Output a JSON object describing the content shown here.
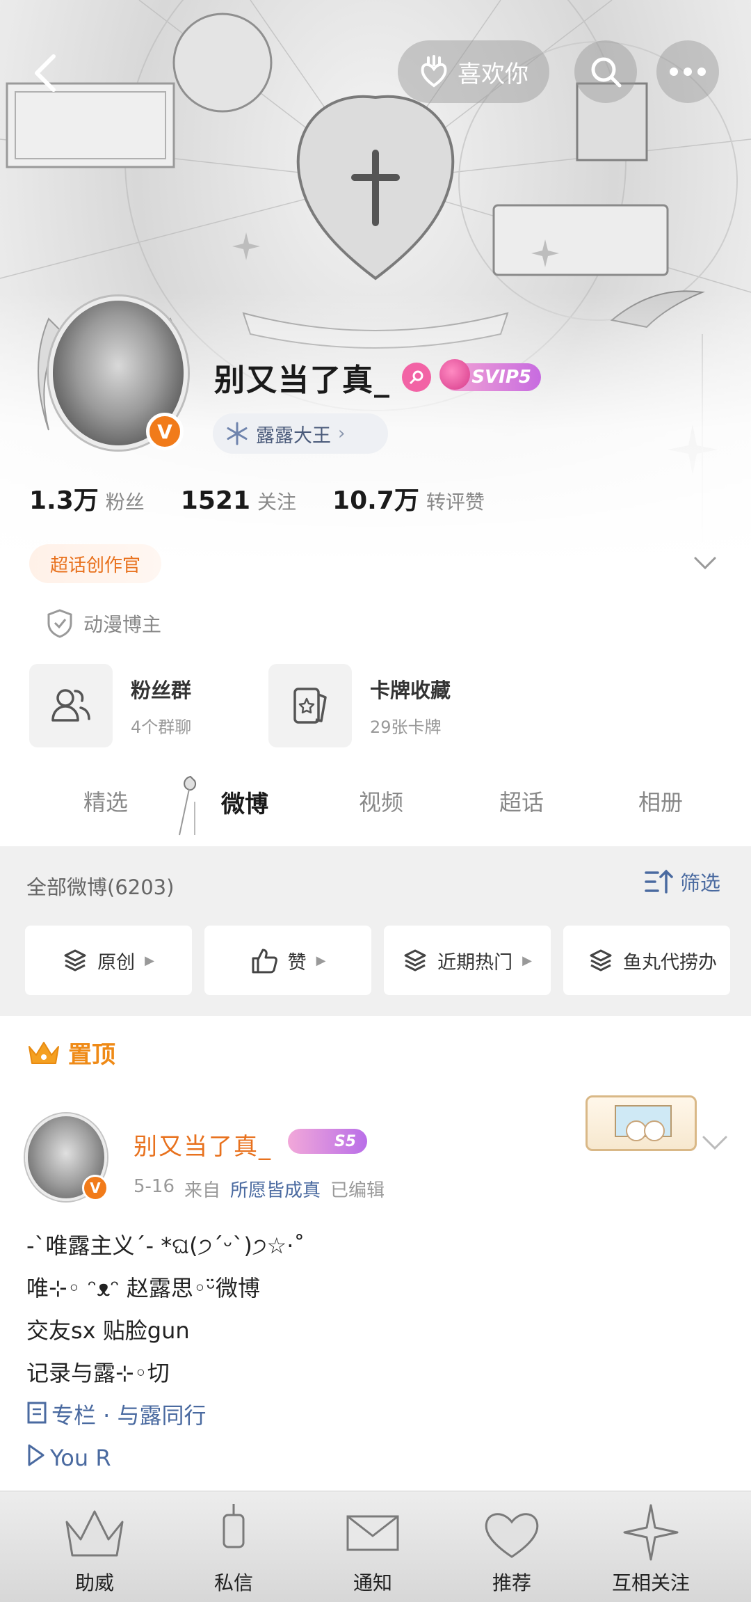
{
  "header": {
    "like_label": "喜欢你",
    "back_icon": "back-arrow-icon",
    "search_icon": "search-icon",
    "more_icon": "more-dots-icon"
  },
  "profile": {
    "nickname": "别又当了真_",
    "svip_label": "SVIP5",
    "group_tag": "露露大王",
    "stats": [
      {
        "value": "1.3万",
        "label": "粉丝"
      },
      {
        "value": "1521",
        "label": "关注"
      },
      {
        "value": "10.7万",
        "label": "转评赞"
      }
    ],
    "creator_tag": "超话创作官",
    "verify_label": "动漫博主",
    "cards": [
      {
        "title": "粉丝群",
        "sub": "4个群聊",
        "icon": "fans-group-icon"
      },
      {
        "title": "卡牌收藏",
        "sub": "29张卡牌",
        "icon": "card-collection-icon"
      }
    ]
  },
  "tabs": [
    {
      "label": "精选",
      "active": false
    },
    {
      "label": "微博",
      "active": true
    },
    {
      "label": "视频",
      "active": false
    },
    {
      "label": "超话",
      "active": false
    },
    {
      "label": "相册",
      "active": false
    }
  ],
  "filter": {
    "all_posts": "全部微博(6203)",
    "filter_label": "筛选",
    "chips": [
      {
        "label": "原创"
      },
      {
        "label": "赞"
      },
      {
        "label": "近期热门"
      },
      {
        "label": "鱼丸代捞办"
      }
    ]
  },
  "post": {
    "pinned_label": "置顶",
    "author": "别又当了真_",
    "level_badge": "S5",
    "date": "5-16",
    "from_label": "来自",
    "source": "所愿皆成真",
    "edited": "已编辑",
    "lines": [
      "-`唯露主义´- *ଘ(੭ˊᵕˋ)੭☆·˚",
      "唯⊹◦ ᵔᴥᵔ 赵露思◦ᵕ̈微博",
      "交友sx 贴脸gun",
      "记录与露⊹◦切",
      "专栏 · 与露同行",
      "You R"
    ]
  },
  "bottom_nav": [
    {
      "label": "助威"
    },
    {
      "label": "私信"
    },
    {
      "label": "通知"
    },
    {
      "label": "推荐"
    },
    {
      "label": "互相关注"
    }
  ],
  "colors": {
    "accent_orange": "#e8711d",
    "link_blue": "#4a6aa0",
    "svip_pink": "#f263a5"
  }
}
